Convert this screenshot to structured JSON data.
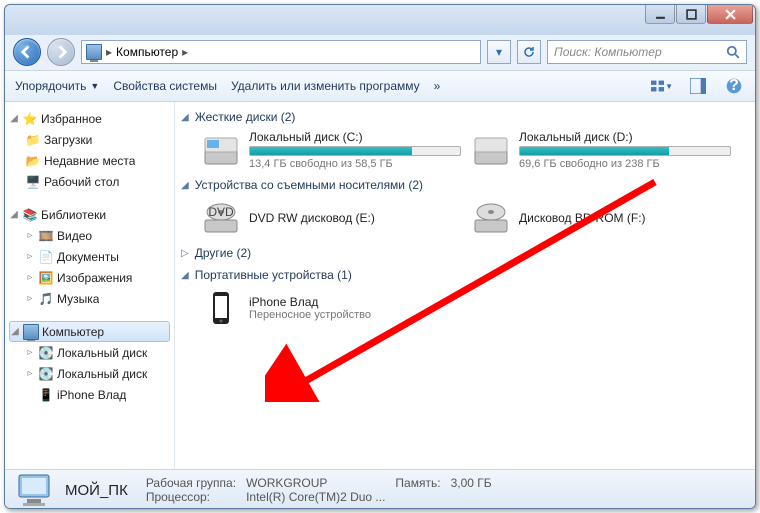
{
  "titlebar": {
    "min": "",
    "max": "",
    "close": ""
  },
  "nav": {
    "location_label": "Компьютер",
    "search_placeholder": "Поиск: Компьютер"
  },
  "toolbar": {
    "organize": "Упорядочить",
    "sysprops": "Свойства системы",
    "uninstall": "Удалить или изменить программу",
    "overflow": "»"
  },
  "sidebar": {
    "favorites": {
      "label": "Избранное",
      "items": [
        {
          "label": "Загрузки"
        },
        {
          "label": "Недавние места"
        },
        {
          "label": "Рабочий стол"
        }
      ]
    },
    "libraries": {
      "label": "Библиотеки",
      "items": [
        {
          "label": "Видео"
        },
        {
          "label": "Документы"
        },
        {
          "label": "Изображения"
        },
        {
          "label": "Музыка"
        }
      ]
    },
    "computer": {
      "label": "Компьютер",
      "items": [
        {
          "label": "Локальный диск"
        },
        {
          "label": "Локальный диск"
        },
        {
          "label": "iPhone Влад"
        }
      ]
    }
  },
  "sections": {
    "hdd": {
      "label": "Жесткие диски (2)",
      "items": [
        {
          "title": "Локальный диск (C:)",
          "sub": "13,4 ГБ свободно из 58,5 ГБ",
          "fill": 77
        },
        {
          "title": "Локальный диск (D:)",
          "sub": "69,6 ГБ свободно из 238 ГБ",
          "fill": 71
        }
      ]
    },
    "removable": {
      "label": "Устройства со съемными носителями (2)",
      "items": [
        {
          "title": "DVD RW дисковод (E:)"
        },
        {
          "title": "Дисковод BD-ROM (F:)"
        }
      ]
    },
    "other": {
      "label": "Другие (2)"
    },
    "portable": {
      "label": "Портативные устройства (1)",
      "items": [
        {
          "title": "iPhone Влад",
          "sub": "Переносное устройство"
        }
      ]
    }
  },
  "status": {
    "name": "МОЙ_ПК",
    "workgroup_label": "Рабочая группа:",
    "workgroup": "WORKGROUP",
    "cpu_label": "Процессор:",
    "cpu": "Intel(R) Core(TM)2 Duo ...",
    "mem_label": "Память:",
    "mem": "3,00 ГБ"
  }
}
